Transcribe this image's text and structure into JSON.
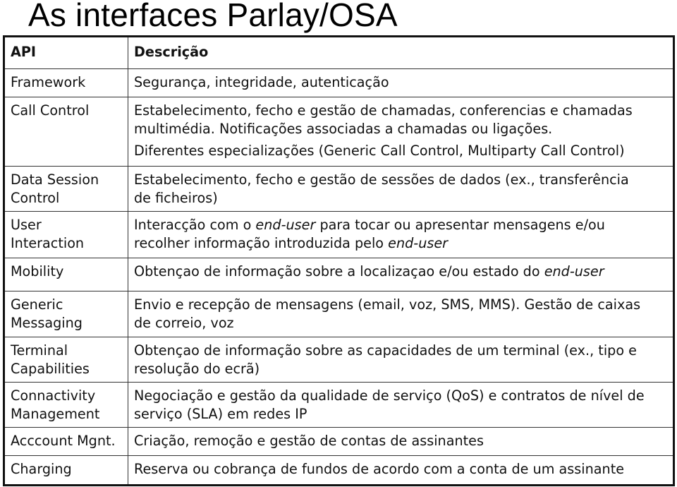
{
  "title": "As interfaces Parlay/OSA",
  "table": {
    "headers": {
      "api": "API",
      "description": "Descrição"
    },
    "rows": [
      {
        "api": "Framework",
        "description": "Segurança, integridade, autenticação"
      },
      {
        "api": "Call Control",
        "description_p1_l1": "Estabelecimento, fecho e gestão de chamadas, conferencias e chamadas",
        "description_p1_l2": "multimédia. Notificações associadas a chamadas ou ligações.",
        "description_p2": "Diferentes especializações (Generic Call Control, Multiparty Call Control)"
      },
      {
        "api_l1": "Data Session",
        "api_l2": "Control",
        "description_l1": "Estabelecimento, fecho e gestão de sessões de dados (ex., transferência",
        "description_l2": "de ficheiros)"
      },
      {
        "api_l1": "User",
        "api_l2": "Interaction",
        "description_l1_a": "Interacção com o ",
        "description_l1_em": "end-user",
        "description_l1_b": " para tocar ou apresentar mensagens e/ou",
        "description_l2_a": "recolher informação introduzida pelo ",
        "description_l2_em": "end-user"
      },
      {
        "api": "Mobility",
        "description_a": "Obtençao de informação sobre a localizaçao e/ou estado do ",
        "description_em": "end-user"
      },
      {
        "api_l1": "Generic",
        "api_l2": "Messaging",
        "description_l1": "Envio e recepção de mensagens (email, voz, SMS, MMS). Gestão de caixas",
        "description_l2": "de correio, voz"
      },
      {
        "api_l1": "Terminal",
        "api_l2": "Capabilities",
        "description_l1": "Obtençao de informação sobre as capacidades de um terminal (ex., tipo e",
        "description_l2": "resolução do ecrã)"
      },
      {
        "api_l1": "Connactivity",
        "api_l2": "Management",
        "description_l1": "Negociação e gestão da qualidade de serviço (QoS) e contratos de nível de",
        "description_l2": "serviço (SLA) em redes IP"
      },
      {
        "api": "Acccount Mgnt.",
        "description": "Criação, remoção e gestão de contas de assinantes"
      },
      {
        "api": "Charging",
        "description": "Reserva ou cobrança de fundos de acordo com a conta de um assinante"
      }
    ]
  }
}
